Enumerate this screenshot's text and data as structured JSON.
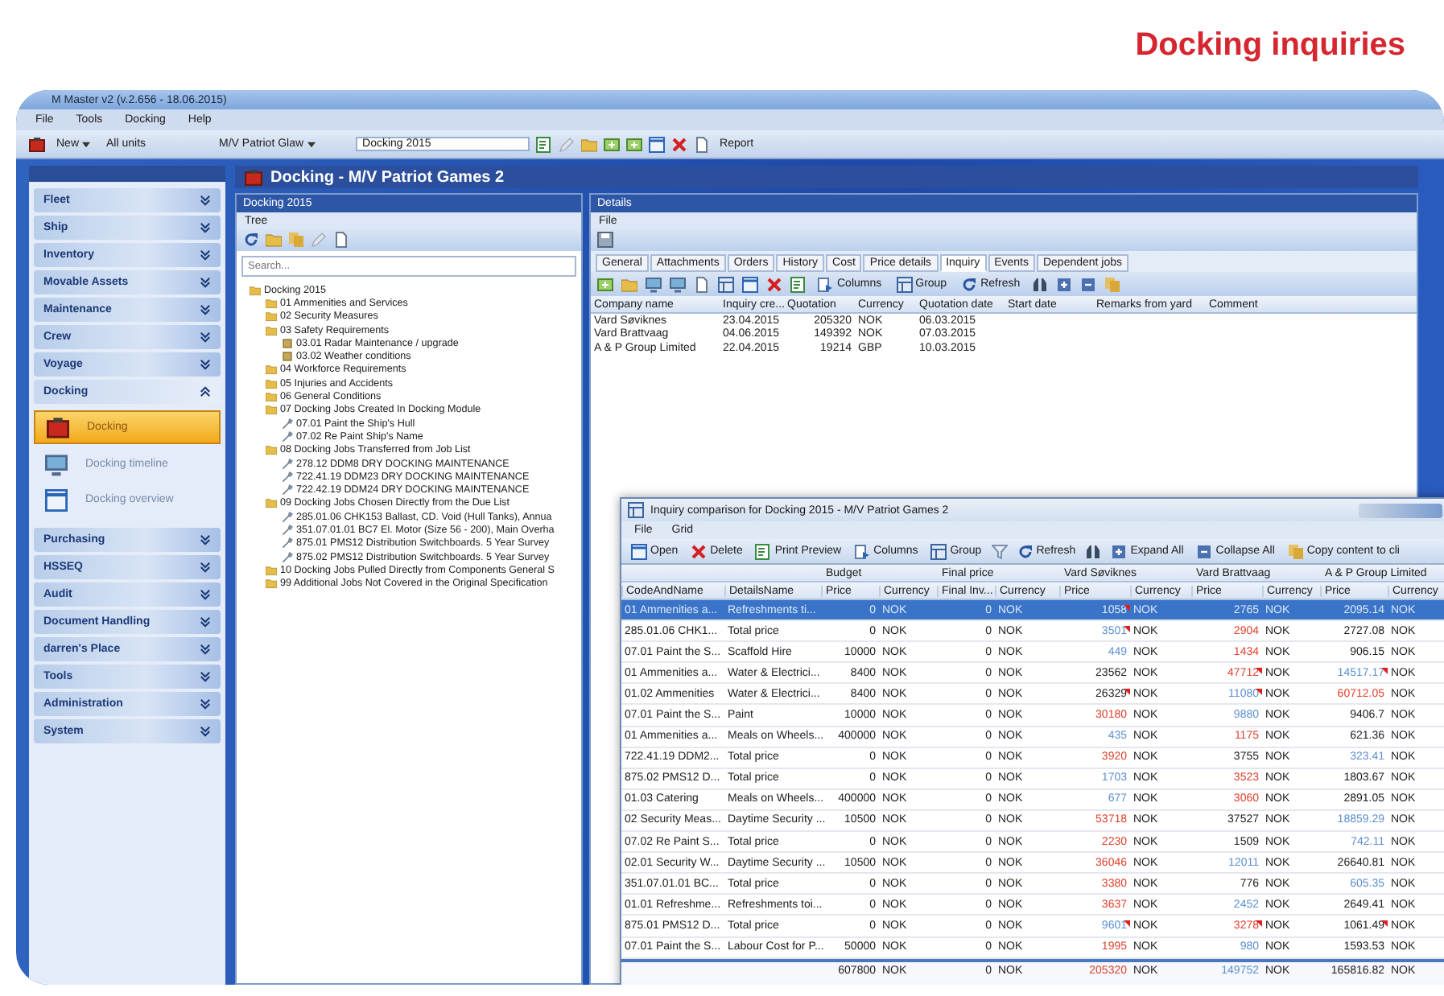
{
  "heading": "Docking inquiries",
  "app": {
    "title": "M Master v2 (v.2.656 - 18.06.2015)",
    "menu": [
      "File",
      "Tools",
      "Docking",
      "Help"
    ],
    "toolbar": {
      "new": "New",
      "units": "All units",
      "vessel": "M/V Patriot Glaw",
      "docking": "Docking 2015",
      "report": "Report"
    }
  },
  "nav": [
    {
      "label": "Fleet",
      "expanded": false
    },
    {
      "label": "Ship",
      "expanded": false
    },
    {
      "label": "Inventory",
      "expanded": false
    },
    {
      "label": "Movable Assets",
      "expanded": false
    },
    {
      "label": "Maintenance",
      "expanded": false
    },
    {
      "label": "Crew",
      "expanded": false
    },
    {
      "label": "Voyage",
      "expanded": false
    },
    {
      "label": "Docking",
      "expanded": true,
      "children": [
        {
          "label": "Docking",
          "selected": true
        },
        {
          "label": "Docking timeline",
          "selected": false
        },
        {
          "label": "Docking overview",
          "selected": false
        }
      ]
    },
    {
      "label": "Purchasing",
      "expanded": false
    },
    {
      "label": "HSSEQ",
      "expanded": false
    },
    {
      "label": "Audit",
      "expanded": false
    },
    {
      "label": "Document Handling",
      "expanded": false
    },
    {
      "label": "darren's Place",
      "expanded": false
    },
    {
      "label": "Tools",
      "expanded": false
    },
    {
      "label": "Administration",
      "expanded": false
    },
    {
      "label": "System",
      "expanded": false
    }
  ],
  "main_title": "Docking - M/V Patriot Games 2",
  "tree": {
    "panel_title": "Docking 2015",
    "menu": "Tree",
    "search": {
      "placeholder": "Search..."
    },
    "nodes": [
      {
        "label": "Docking 2015",
        "kind": "folder",
        "children": [
          {
            "label": "01 Ammenities and Services",
            "kind": "folder"
          },
          {
            "label": "02 Security Measures",
            "kind": "folder"
          },
          {
            "label": "03 Safety Requirements",
            "kind": "folder",
            "children": [
              {
                "label": "03.01 Radar Maintenance / upgrade",
                "kind": "item"
              },
              {
                "label": "03.02 Weather conditions",
                "kind": "item"
              }
            ]
          },
          {
            "label": "04 Workforce Requirements",
            "kind": "folder"
          },
          {
            "label": "05 Injuries and Accidents",
            "kind": "folder"
          },
          {
            "label": "06 General Conditions",
            "kind": "folder"
          },
          {
            "label": "07 Docking Jobs Created In Docking Module",
            "kind": "folder",
            "children": [
              {
                "label": "07.01 Paint the Ship's Hull",
                "kind": "job"
              },
              {
                "label": "07.02 Re Paint Ship's Name",
                "kind": "job"
              }
            ]
          },
          {
            "label": "08 Docking Jobs Transferred from Job List",
            "kind": "folder",
            "children": [
              {
                "label": "278.12 DDM8 DRY DOCKING MAINTENANCE",
                "kind": "job"
              },
              {
                "label": "722.41.19 DDM23 DRY DOCKING MAINTENANCE",
                "kind": "job"
              },
              {
                "label": "722.42.19 DDM24 DRY DOCKING MAINTENANCE",
                "kind": "job"
              }
            ]
          },
          {
            "label": "09 Docking Jobs Chosen Directly from the Due List",
            "kind": "folder",
            "children": [
              {
                "label": "285.01.06 CHK153 Ballast, CD. Void (Hull Tanks), Annua",
                "kind": "job"
              },
              {
                "label": "351.07.01.01 BC7 El. Motor (Size 56 - 200), Main Overha",
                "kind": "job"
              },
              {
                "label": "875.01 PMS12 Distribution Switchboards. 5 Year Survey",
                "kind": "job"
              },
              {
                "label": "875.02 PMS12 Distribution Switchboards. 5 Year Survey",
                "kind": "job"
              }
            ]
          },
          {
            "label": "10 Docking Jobs Pulled Directly from Components General S",
            "kind": "folder"
          },
          {
            "label": "99 Additional Jobs Not Covered in the Original Specification",
            "kind": "folder"
          }
        ]
      }
    ]
  },
  "details": {
    "panel_title": "Details",
    "menu": "File",
    "tabs": [
      {
        "label": "General",
        "selected": false
      },
      {
        "label": "Attachments",
        "selected": false
      },
      {
        "label": "Orders",
        "selected": false
      },
      {
        "label": "History",
        "selected": false
      },
      {
        "label": "Cost",
        "selected": false
      },
      {
        "label": "Price details",
        "selected": false
      },
      {
        "label": "Inquiry",
        "selected": true
      },
      {
        "label": "Events",
        "selected": false
      },
      {
        "label": "Dependent jobs",
        "selected": false
      }
    ],
    "toolbar": [
      "Columns",
      "Group",
      "Refresh"
    ],
    "columns": [
      "Company name",
      "Inquiry cre...",
      "Quotation",
      "Currency",
      "Quotation date",
      "Start date",
      "Remarks from yard",
      "Comment"
    ],
    "rows": [
      [
        "Vard Søviknes",
        "23.04.2015",
        "205320",
        "NOK",
        "06.03.2015"
      ],
      [
        "Vard Brattvaag",
        "04.06.2015",
        "149392",
        "NOK",
        "07.03.2015"
      ],
      [
        "A & P Group Limited",
        "22.04.2015",
        "19214",
        "GBP",
        "10.03.2015"
      ]
    ]
  },
  "dialog": {
    "title": "Inquiry comparison for Docking 2015 - M/V Patriot Games 2",
    "menu": [
      "File",
      "Grid"
    ],
    "toolbar": [
      "Open",
      "Delete",
      "Print Preview",
      "Columns",
      "Group",
      "Refresh",
      "Expand All",
      "Collapse All",
      "Copy content to cli"
    ],
    "groups": [
      "Budget",
      "Final price",
      "Vard Søviknes",
      "Vard Brattvaag",
      "A & P Group Limited"
    ],
    "columns": [
      "CodeAndName",
      "DetailsName",
      "Price",
      "Currency",
      "Final Inv...",
      "Currency",
      "Price",
      "Currency",
      "Price",
      "Currency",
      "Price",
      "Currency"
    ],
    "rows": [
      {
        "selected": true,
        "cells": [
          "01 Ammenities a...",
          "Refreshments ti...",
          "0",
          "NOK",
          "0",
          "NOK"
        ],
        "quotes": [
          {
            "price": "1058",
            "currency": "NOK",
            "flag": true
          },
          {
            "price": "2765",
            "currency": "NOK",
            "flag": false
          },
          {
            "price": "2095.14",
            "currency": "NOK",
            "flag": false
          }
        ]
      },
      {
        "selected": false,
        "cells": [
          "285.01.06 CHK1...",
          "Total price",
          "0",
          "NOK",
          "0",
          "NOK"
        ],
        "quotes": [
          {
            "price": "3501",
            "currency": "NOK",
            "color": "#5b8fd0",
            "flag": true
          },
          {
            "price": "2904",
            "currency": "NOK",
            "color": "#e0402a",
            "flag": false
          },
          {
            "price": "2727.08",
            "currency": "NOK",
            "flag": false
          }
        ]
      },
      {
        "selected": false,
        "cells": [
          "07.01 Paint the S...",
          "Scaffold Hire",
          "10000",
          "NOK",
          "0",
          "NOK"
        ],
        "quotes": [
          {
            "price": "449",
            "currency": "NOK",
            "color": "#5b8fd0",
            "flag": false
          },
          {
            "price": "1434",
            "currency": "NOK",
            "color": "#e0402a",
            "flag": false
          },
          {
            "price": "906.15",
            "currency": "NOK",
            "flag": false
          }
        ]
      },
      {
        "selected": false,
        "cells": [
          "01 Ammenities a...",
          "Water & Electrici...",
          "8400",
          "NOK",
          "0",
          "NOK"
        ],
        "quotes": [
          {
            "price": "23562",
            "currency": "NOK",
            "flag": false
          },
          {
            "price": "47712",
            "currency": "NOK",
            "color": "#e0402a",
            "flag": true
          },
          {
            "price": "14517.17",
            "currency": "NOK",
            "color": "#5b8fd0",
            "flag": true
          }
        ]
      },
      {
        "selected": false,
        "cells": [
          "01.02 Ammenities",
          "Water & Electrici...",
          "8400",
          "NOK",
          "0",
          "NOK"
        ],
        "quotes": [
          {
            "price": "26329",
            "currency": "NOK",
            "flag": true
          },
          {
            "price": "11080",
            "currency": "NOK",
            "color": "#5b8fd0",
            "flag": true
          },
          {
            "price": "60712.05",
            "currency": "NOK",
            "color": "#e0402a",
            "flag": false
          }
        ]
      },
      {
        "selected": false,
        "cells": [
          "07.01 Paint the S...",
          "Paint",
          "10000",
          "NOK",
          "0",
          "NOK"
        ],
        "quotes": [
          {
            "price": "30180",
            "currency": "NOK",
            "color": "#e0402a",
            "flag": false
          },
          {
            "price": "9880",
            "currency": "NOK",
            "color": "#5b8fd0",
            "flag": false
          },
          {
            "price": "9406.7",
            "currency": "NOK",
            "flag": false
          }
        ]
      },
      {
        "selected": false,
        "cells": [
          "01 Ammenities a...",
          "Meals on Wheels...",
          "400000",
          "NOK",
          "0",
          "NOK"
        ],
        "quotes": [
          {
            "price": "435",
            "currency": "NOK",
            "color": "#5b8fd0",
            "flag": false
          },
          {
            "price": "1175",
            "currency": "NOK",
            "color": "#e0402a",
            "flag": false
          },
          {
            "price": "621.36",
            "currency": "NOK",
            "flag": false
          }
        ]
      },
      {
        "selected": false,
        "cells": [
          "722.41.19 DDM2...",
          "Total price",
          "0",
          "NOK",
          "0",
          "NOK"
        ],
        "quotes": [
          {
            "price": "3920",
            "currency": "NOK",
            "color": "#e0402a",
            "flag": false
          },
          {
            "price": "3755",
            "currency": "NOK",
            "flag": false
          },
          {
            "price": "323.41",
            "currency": "NOK",
            "color": "#5b8fd0",
            "flag": false
          }
        ]
      },
      {
        "selected": false,
        "cells": [
          "875.02 PMS12 D...",
          "Total price",
          "0",
          "NOK",
          "0",
          "NOK"
        ],
        "quotes": [
          {
            "price": "1703",
            "currency": "NOK",
            "color": "#5b8fd0",
            "flag": false
          },
          {
            "price": "3523",
            "currency": "NOK",
            "color": "#e0402a",
            "flag": false
          },
          {
            "price": "1803.67",
            "currency": "NOK",
            "flag": false
          }
        ]
      },
      {
        "selected": false,
        "cells": [
          "01.03 Catering",
          "Meals on Wheels...",
          "400000",
          "NOK",
          "0",
          "NOK"
        ],
        "quotes": [
          {
            "price": "677",
            "currency": "NOK",
            "color": "#5b8fd0",
            "flag": false
          },
          {
            "price": "3060",
            "currency": "NOK",
            "color": "#e0402a",
            "flag": false
          },
          {
            "price": "2891.05",
            "currency": "NOK",
            "flag": false
          }
        ]
      },
      {
        "selected": false,
        "cells": [
          "02 Security Meas...",
          "Daytime Security ...",
          "10500",
          "NOK",
          "0",
          "NOK"
        ],
        "quotes": [
          {
            "price": "53718",
            "currency": "NOK",
            "color": "#e0402a",
            "flag": false
          },
          {
            "price": "37527",
            "currency": "NOK",
            "flag": false
          },
          {
            "price": "18859.29",
            "currency": "NOK",
            "color": "#5b8fd0",
            "flag": false
          }
        ]
      },
      {
        "selected": false,
        "cells": [
          "07.02 Re Paint S...",
          "Total price",
          "0",
          "NOK",
          "0",
          "NOK"
        ],
        "quotes": [
          {
            "price": "2230",
            "currency": "NOK",
            "color": "#e0402a",
            "flag": false
          },
          {
            "price": "1509",
            "currency": "NOK",
            "flag": false
          },
          {
            "price": "742.11",
            "currency": "NOK",
            "color": "#5b8fd0",
            "flag": false
          }
        ]
      },
      {
        "selected": false,
        "cells": [
          "02.01 Security W...",
          "Daytime Security ...",
          "10500",
          "NOK",
          "0",
          "NOK"
        ],
        "quotes": [
          {
            "price": "36046",
            "currency": "NOK",
            "color": "#e0402a",
            "flag": false
          },
          {
            "price": "12011",
            "currency": "NOK",
            "color": "#5b8fd0",
            "flag": false
          },
          {
            "price": "26640.81",
            "currency": "NOK",
            "flag": false
          }
        ]
      },
      {
        "selected": false,
        "cells": [
          "351.07.01.01 BC...",
          "Total price",
          "0",
          "NOK",
          "0",
          "NOK"
        ],
        "quotes": [
          {
            "price": "3380",
            "currency": "NOK",
            "color": "#e0402a",
            "flag": false
          },
          {
            "price": "776",
            "currency": "NOK",
            "flag": false
          },
          {
            "price": "605.35",
            "currency": "NOK",
            "color": "#5b8fd0",
            "flag": false
          }
        ]
      },
      {
        "selected": false,
        "cells": [
          "01.01 Refreshme...",
          "Refreshments toi...",
          "0",
          "NOK",
          "0",
          "NOK"
        ],
        "quotes": [
          {
            "price": "3637",
            "currency": "NOK",
            "color": "#e0402a",
            "flag": false
          },
          {
            "price": "2452",
            "currency": "NOK",
            "color": "#5b8fd0",
            "flag": false
          },
          {
            "price": "2649.41",
            "currency": "NOK",
            "flag": false
          }
        ]
      },
      {
        "selected": false,
        "cells": [
          "875.01 PMS12 D...",
          "Total price",
          "0",
          "NOK",
          "0",
          "NOK"
        ],
        "quotes": [
          {
            "price": "9601",
            "currency": "NOK",
            "color": "#5b8fd0",
            "flag": true
          },
          {
            "price": "3278",
            "currency": "NOK",
            "color": "#e0402a",
            "flag": true
          },
          {
            "price": "1061.49",
            "currency": "NOK",
            "flag": true
          }
        ]
      },
      {
        "selected": false,
        "cells": [
          "07.01 Paint the S...",
          "Labour Cost for P...",
          "50000",
          "NOK",
          "0",
          "NOK"
        ],
        "quotes": [
          {
            "price": "1995",
            "currency": "NOK",
            "color": "#e0402a",
            "flag": false
          },
          {
            "price": "980",
            "currency": "NOK",
            "color": "#5b8fd0",
            "flag": false
          },
          {
            "price": "1593.53",
            "currency": "NOK",
            "flag": false
          }
        ]
      }
    ],
    "total": {
      "cells": [
        "607800",
        "NOK",
        "0",
        "NOK"
      ],
      "quotes": [
        {
          "price": "205320",
          "currency": "NOK",
          "color": "#e0402a"
        },
        {
          "price": "149752",
          "currency": "NOK",
          "color": "#5b8fd0"
        },
        {
          "price": "165816.82",
          "currency": "NOK"
        }
      ]
    }
  }
}
